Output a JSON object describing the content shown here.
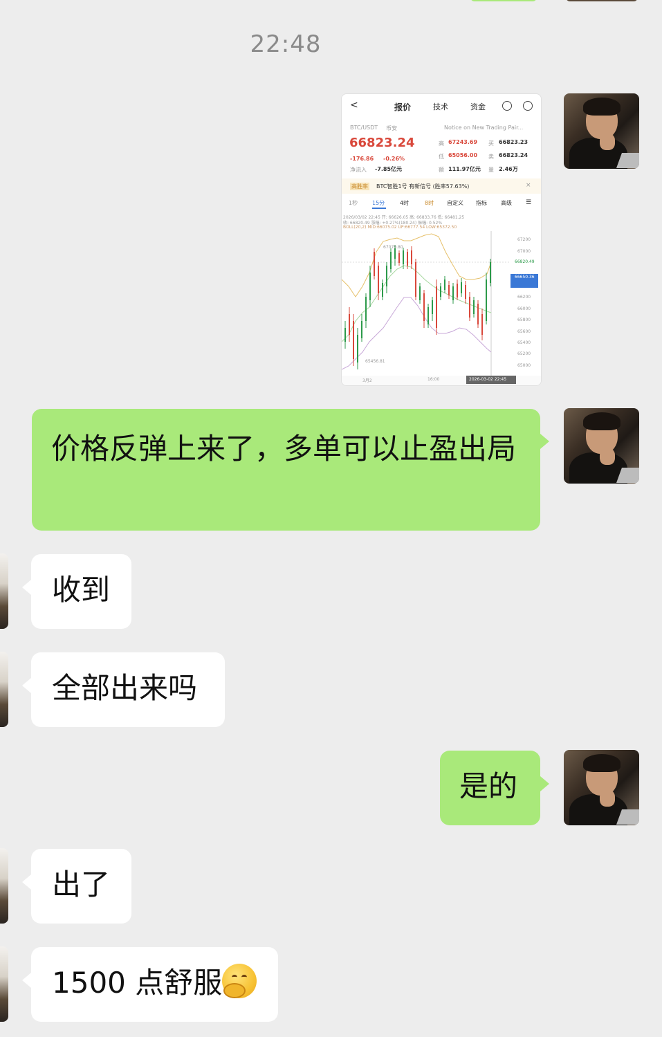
{
  "timestamp": "22:48",
  "screenshot": {
    "header": {
      "back": "<",
      "tab_quote": "报价",
      "tab_tech": "技术",
      "tab_funds": "资金"
    },
    "pair": "BTC/USDT",
    "exchange": "币安",
    "notice": "Notice on New Trading Pair...",
    "price": "66823.24",
    "change": "-176.86",
    "change_pct": "-0.26%",
    "net_inflow_label": "净流入",
    "net_inflow": "-7.85亿元",
    "high_label": "高",
    "high": "67243.69",
    "low_label": "低",
    "low": "65056.00",
    "amount_label": "额",
    "amount": "111.97亿元",
    "buy_label": "买",
    "buy": "66823.23",
    "sell_label": "卖",
    "sell": "66823.24",
    "vol_label": "量",
    "vol": "2.46万",
    "signal_tag": "高胜率",
    "signal_text": "BTC智胜1号 有新信号 (胜率57.63%)",
    "intervals": [
      "1秒",
      "15分",
      "4时",
      "8时",
      "自定义",
      "指标",
      "高级"
    ],
    "info_line1": "2026/03/02 22:45 开: 66626.05 高: 66833.76 低: 66481.25",
    "info_line2": "收: 66820.49 涨幅: +0.27%(180.24) 振幅: 0.52%",
    "info_line3": "BOLL(20,2) MID:66075.02 UP:66777.54 LOW:65372.50",
    "peak_label": "67079.80",
    "trough_label": "65456.81",
    "current_price_tag": "66820.49",
    "y_labels": [
      "67200",
      "67000",
      "66820.49",
      "66650.36",
      "66200",
      "66000",
      "65800",
      "65600",
      "65400",
      "65200",
      "65000"
    ],
    "x_labels": [
      "3月2",
      "16:00",
      "2026-03-02 22:45"
    ]
  },
  "messages": [
    {
      "side": "right",
      "text": "价格反弹上来了，多单可以止盈出局"
    },
    {
      "side": "left",
      "text": "收到"
    },
    {
      "side": "left",
      "text": "全部出来吗"
    },
    {
      "side": "right",
      "text": "是的"
    },
    {
      "side": "left",
      "text": "出了"
    },
    {
      "side": "left",
      "text": "1500 点舒服",
      "emoji": "hugging-face-emoji"
    }
  ]
}
